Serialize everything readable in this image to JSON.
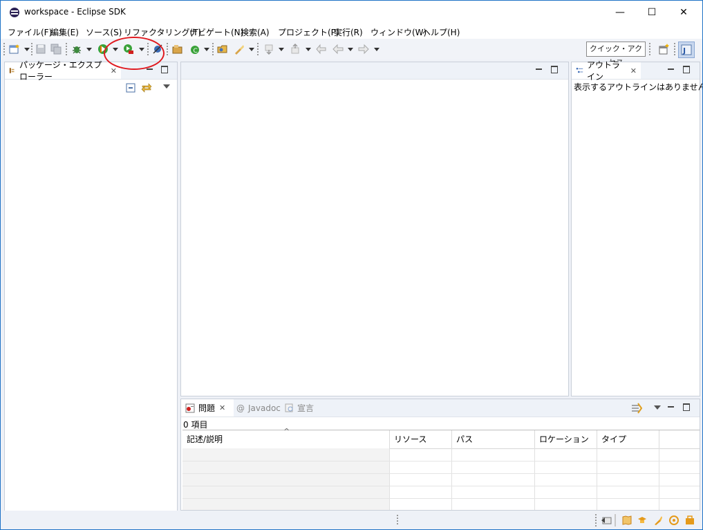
{
  "window": {
    "title": "workspace - Eclipse SDK",
    "controls": {
      "minimize": "—",
      "maximize": "☐",
      "close": "✕"
    }
  },
  "menubar": [
    {
      "label": "ファイル(F)"
    },
    {
      "label": "編集(E)"
    },
    {
      "label": "ソース(S)"
    },
    {
      "label": "リファクタリング(T)"
    },
    {
      "label": "ナビゲート(N)"
    },
    {
      "label": "検索(A)"
    },
    {
      "label": "プロジェクト(P)"
    },
    {
      "label": "実行(R)"
    },
    {
      "label": "ウィンドウ(W)"
    },
    {
      "label": "ヘルプ(H)"
    }
  ],
  "toolbar": {
    "quick_access": "クイック・アクセス",
    "icons": [
      "new-icon",
      "save-icon",
      "save-all-icon",
      "debug-icon",
      "run-icon",
      "coverage-run-icon",
      "skip-breakpoints-icon",
      "new-java-project-icon",
      "new-class-icon",
      "open-type-icon",
      "search-icon",
      "next-annotation-icon",
      "previous-annotation-icon",
      "last-edit-icon",
      "back-icon",
      "forward-icon",
      "open-perspective-icon",
      "java-perspective-icon"
    ]
  },
  "package_explorer": {
    "tab_label": "パッケージ・エクスプローラー",
    "close": "✕"
  },
  "outline": {
    "tab_label": "アウトライン",
    "close": "✕",
    "message": "表示するアウトラインはありません。"
  },
  "problems": {
    "tabs": [
      {
        "label": "問題",
        "active": true
      },
      {
        "label": "Javadoc",
        "active": false
      },
      {
        "label": "宣言",
        "active": false
      }
    ],
    "close": "✕",
    "item_count": "0 項目",
    "sort_indicator": "^",
    "columns": [
      "記述/説明",
      "リソース",
      "パス",
      "ロケーション",
      "タイプ"
    ]
  },
  "colors": {
    "accent": "#1e72c6",
    "highlight_circle": "#e0191f",
    "panel_bg": "#ffffff",
    "chrome_bg": "#eef1f7"
  }
}
